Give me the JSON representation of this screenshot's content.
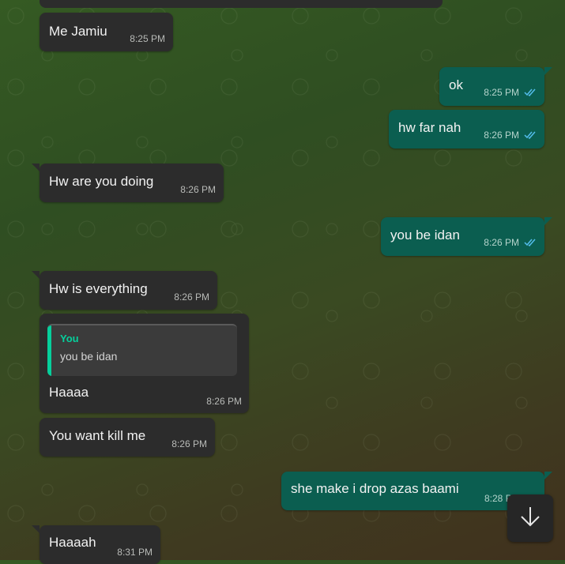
{
  "messages": [
    {
      "text": "Me Jamiu",
      "time": "8:25 PM",
      "direction": "in"
    },
    {
      "text": "ok",
      "time": "8:25 PM",
      "direction": "out",
      "status": "read"
    },
    {
      "text": "hw far nah",
      "time": "8:26 PM",
      "direction": "out",
      "status": "read"
    },
    {
      "text": "Hw are you doing",
      "time": "8:26 PM",
      "direction": "in"
    },
    {
      "text": "you be idan",
      "time": "8:26 PM",
      "direction": "out",
      "status": "read"
    },
    {
      "text": "Hw is everything",
      "time": "8:26 PM",
      "direction": "in"
    },
    {
      "text": "Haaaa",
      "time": "8:26 PM",
      "direction": "in",
      "quote": {
        "author": "You",
        "text": "you be idan"
      }
    },
    {
      "text": "You want kill me",
      "time": "8:26 PM",
      "direction": "in"
    },
    {
      "text": "she make i drop azas baami",
      "time": "8:28 P",
      "direction": "out"
    },
    {
      "text": "Haaaah",
      "time": "8:31 PM",
      "direction": "in"
    }
  ],
  "colors": {
    "incoming": "#2c2c2c",
    "outgoing": "#0b5e50",
    "accent": "#06cf9c",
    "read_tick": "#53bdeb"
  },
  "icons": {
    "read_receipt": "double-check-icon",
    "scroll_down": "arrow-down-icon"
  }
}
